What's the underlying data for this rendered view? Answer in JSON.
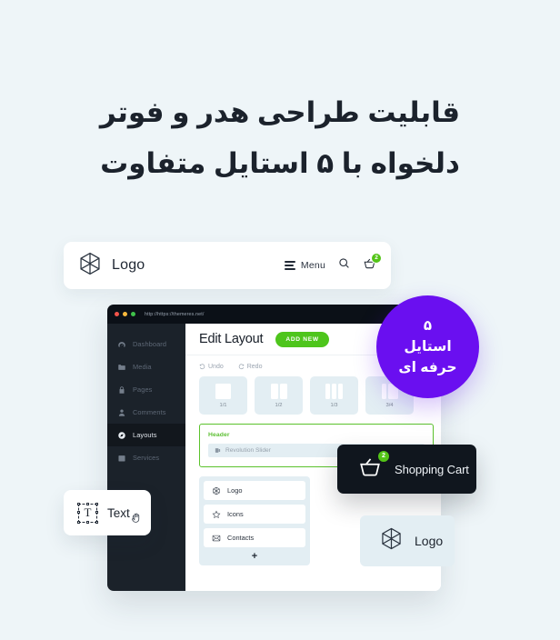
{
  "page": {
    "background": "#eef5f8",
    "accent_green": "#4ec51c",
    "accent_purple": "#6a0ff0",
    "dark": "#10161e"
  },
  "headline": {
    "line1": "قابلیت طراحی هدر و فوتر",
    "line2": "دلخواه با ۵ استایل متفاوت"
  },
  "site_header": {
    "logo_icon": "cube-icon",
    "logo_text": "Logo",
    "menu_icon": "hamburger-icon",
    "menu_label": "Menu",
    "search_icon": "search-icon",
    "cart_icon": "shopping-cart-icon",
    "cart_count": "2"
  },
  "window": {
    "traffic_lights": [
      "close-red",
      "minimize-yellow",
      "maximize-green"
    ],
    "url": "http://https://themeres.net/",
    "sidebar": {
      "items": [
        {
          "label": "Dashboard",
          "icon": "gauge-icon",
          "active": false
        },
        {
          "label": "Media",
          "icon": "folder-icon",
          "active": false
        },
        {
          "label": "Pages",
          "icon": "lock-icon",
          "active": false
        },
        {
          "label": "Comments",
          "icon": "user-icon",
          "active": false
        },
        {
          "label": "Layouts",
          "icon": "compass-icon",
          "active": true
        },
        {
          "label": "Services",
          "icon": "calendar-icon",
          "active": false
        }
      ]
    },
    "content": {
      "title": "Edit Layout",
      "add_new_label": "ADD NEW",
      "undo_label": "Undo",
      "redo_label": "Redo",
      "grid_options": [
        {
          "label": "1/1",
          "columns": 1
        },
        {
          "label": "1/2",
          "columns": 2
        },
        {
          "label": "1/3",
          "columns": 3
        },
        {
          "label": "3/4",
          "columns": 2
        }
      ],
      "header_section": {
        "title": "Header",
        "row_icon": "slider-icon",
        "row_label": "Revolution Slider"
      },
      "component_list": {
        "items": [
          {
            "label": "Logo",
            "icon": "cube-icon"
          },
          {
            "label": "Icons",
            "icon": "star-icon"
          },
          {
            "label": "Contacts",
            "icon": "envelope-icon"
          }
        ],
        "add_label": "+"
      }
    }
  },
  "styles_badge": {
    "number": "۵",
    "line1": "استایل",
    "line2": "حرفه ای"
  },
  "cart_card": {
    "icon": "shopping-cart-icon",
    "count": "2",
    "label": "Shopping Cart"
  },
  "text_card": {
    "glyph": "T",
    "label": "Text",
    "cursor_icon": "grab-hand-icon"
  },
  "logo_card": {
    "icon": "cube-icon",
    "label": "Logo"
  }
}
